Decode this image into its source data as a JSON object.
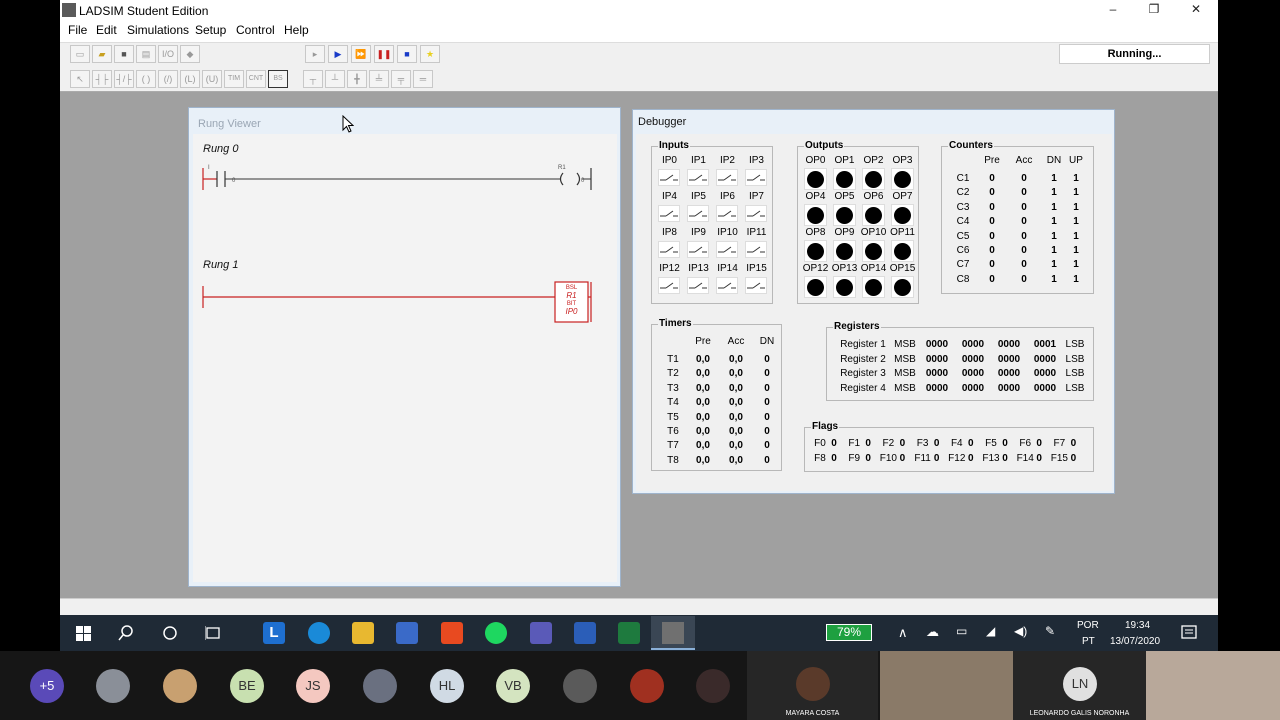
{
  "window": {
    "title": "LADSIM Student Edition",
    "minimize": "–",
    "maximize": "❐",
    "close": "✕"
  },
  "menu": [
    "File",
    "Edit",
    "Simulations",
    "Setup",
    "Control",
    "Help"
  ],
  "toolbar": {
    "io_label": "I/O",
    "status": "Running...",
    "row2_labels": [
      "TIM",
      "CNT",
      "BS"
    ]
  },
  "rung_viewer": {
    "title": "Rung Viewer",
    "rungs": [
      {
        "label": "Rung 0",
        "contact": "I",
        "contact_num": "0",
        "coil": "R1",
        "coil_num": "0"
      },
      {
        "label": "Rung 1",
        "block_lines": [
          "BSL",
          "R1",
          "BIT",
          "IP0"
        ]
      }
    ]
  },
  "debugger": {
    "title": "Debugger",
    "inputs": {
      "title": "Inputs",
      "names": [
        "IP0",
        "IP1",
        "IP2",
        "IP3",
        "IP4",
        "IP5",
        "IP6",
        "IP7",
        "IP8",
        "IP9",
        "IP10",
        "IP11",
        "IP12",
        "IP13",
        "IP14",
        "IP15"
      ]
    },
    "outputs": {
      "title": "Outputs",
      "names": [
        "OP0",
        "OP1",
        "OP2",
        "OP3",
        "OP4",
        "OP5",
        "OP6",
        "OP7",
        "OP8",
        "OP9",
        "OP10",
        "OP11",
        "OP12",
        "OP13",
        "OP14",
        "OP15"
      ]
    },
    "counters": {
      "title": "Counters",
      "headers": [
        "Pre",
        "Acc",
        "DN",
        "UP"
      ],
      "rows": [
        [
          "C1",
          "0",
          "0",
          "1",
          "1"
        ],
        [
          "C2",
          "0",
          "0",
          "1",
          "1"
        ],
        [
          "C3",
          "0",
          "0",
          "1",
          "1"
        ],
        [
          "C4",
          "0",
          "0",
          "1",
          "1"
        ],
        [
          "C5",
          "0",
          "0",
          "1",
          "1"
        ],
        [
          "C6",
          "0",
          "0",
          "1",
          "1"
        ],
        [
          "C7",
          "0",
          "0",
          "1",
          "1"
        ],
        [
          "C8",
          "0",
          "0",
          "1",
          "1"
        ]
      ]
    },
    "timers": {
      "title": "Timers",
      "headers": [
        "Pre",
        "Acc",
        "DN"
      ],
      "rows": [
        [
          "T1",
          "0,0",
          "0,0",
          "0"
        ],
        [
          "T2",
          "0,0",
          "0,0",
          "0"
        ],
        [
          "T3",
          "0,0",
          "0,0",
          "0"
        ],
        [
          "T4",
          "0,0",
          "0,0",
          "0"
        ],
        [
          "T5",
          "0,0",
          "0,0",
          "0"
        ],
        [
          "T6",
          "0,0",
          "0,0",
          "0"
        ],
        [
          "T7",
          "0,0",
          "0,0",
          "0"
        ],
        [
          "T8",
          "0,0",
          "0,0",
          "0"
        ]
      ]
    },
    "registers": {
      "title": "Registers",
      "msb": "MSB",
      "lsb": "LSB",
      "rows": [
        {
          "name": "Register 1",
          "nibbles": [
            "0000",
            "0000",
            "0000",
            "0001"
          ]
        },
        {
          "name": "Register 2",
          "nibbles": [
            "0000",
            "0000",
            "0000",
            "0000"
          ]
        },
        {
          "name": "Register 3",
          "nibbles": [
            "0000",
            "0000",
            "0000",
            "0000"
          ]
        },
        {
          "name": "Register 4",
          "nibbles": [
            "0000",
            "0000",
            "0000",
            "0000"
          ]
        }
      ]
    },
    "flags": {
      "title": "Flags",
      "rows": [
        [
          [
            "F0",
            "0"
          ],
          [
            "F1",
            "0"
          ],
          [
            "F2",
            "0"
          ],
          [
            "F3",
            "0"
          ],
          [
            "F4",
            "0"
          ],
          [
            "F5",
            "0"
          ],
          [
            "F6",
            "0"
          ],
          [
            "F7",
            "0"
          ]
        ],
        [
          [
            "F8",
            "0"
          ],
          [
            "F9",
            "0"
          ],
          [
            "F10",
            "0"
          ],
          [
            "F11",
            "0"
          ],
          [
            "F12",
            "0"
          ],
          [
            "F13",
            "0"
          ],
          [
            "F14",
            "0"
          ],
          [
            "F15",
            "0"
          ]
        ]
      ]
    }
  },
  "taskbar": {
    "battery": "79%",
    "lang": "POR",
    "lang2": "PT",
    "time": "19:34",
    "date": "13/07/2020",
    "l_app": "L"
  },
  "participants": {
    "more": "+5",
    "initials": [
      "BE",
      "JS",
      "HL",
      "VB",
      "LN"
    ],
    "names": [
      "MAYARA COSTA",
      "LEONARDO GALIS NORONHA"
    ]
  }
}
